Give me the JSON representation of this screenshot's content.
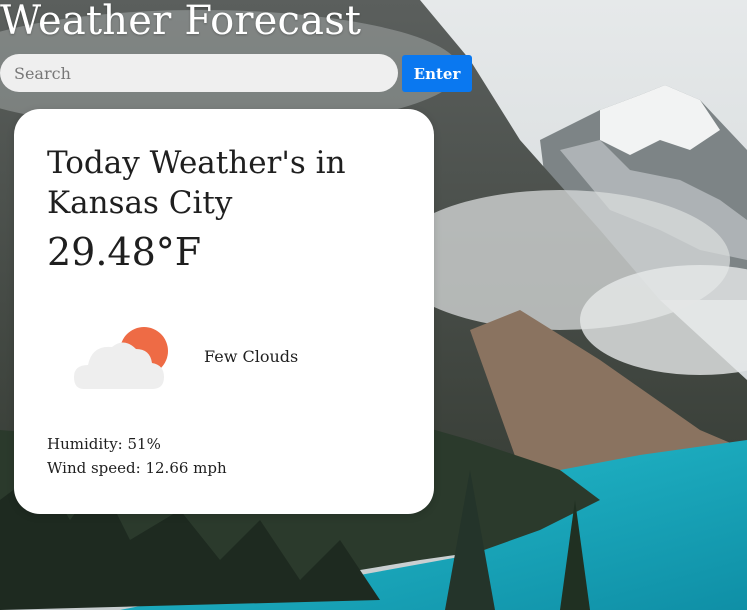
{
  "app": {
    "title": "Weather Forecast"
  },
  "search": {
    "placeholder": "Search",
    "value": "",
    "button_label": "Enter"
  },
  "weather": {
    "heading": "Today Weather's in Kansas City",
    "temperature": "29.48°F",
    "condition": "Few Clouds",
    "condition_icon": "few-clouds-icon",
    "humidity": "Humidity: 51%",
    "wind": "Wind speed: 12.66 mph"
  },
  "colors": {
    "button": "#0a78f0",
    "card": "#ffffff",
    "search_bg": "#efefef",
    "sun": "#ee6b45",
    "cloud": "#eeeeee",
    "lake": "#1fb5c8"
  }
}
